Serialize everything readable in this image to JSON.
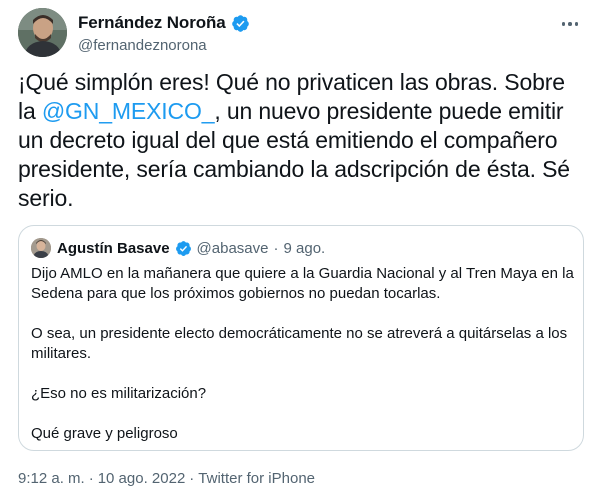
{
  "author": {
    "display_name": "Fernández Noroña",
    "handle": "@fernandeznorona",
    "avatar_icon": "avatar-photo"
  },
  "more_icon": "more-horizontal-icon",
  "tweet": {
    "text_before": "¡Qué simplón eres! Qué no privaticen las obras. Sobre la ",
    "mention": "@GN_MEXICO_",
    "text_after": ", un nuevo presidente puede emitir un decreto igual del que está emitiendo el compañero presidente, sería cambiando la adscripción de ésta. Sé serio."
  },
  "quote": {
    "display_name": "Agustín Basave",
    "handle": "@abasave",
    "separator": "·",
    "date": "9 ago.",
    "paragraphs": [
      "Dijo AMLO en la mañanera que quiere a la Guardia Nacional y al Tren Maya en la Sedena para que los próximos gobiernos no puedan tocarlas.",
      "O sea, un presidente electo democráticamente no se atreverá a quitárselas a los militares.",
      "¿Eso no es militarización?",
      "Qué grave y peligroso"
    ]
  },
  "meta": {
    "time": "9:12 a. m.",
    "sep1": "·",
    "date": "10 ago. 2022",
    "sep2": "·",
    "source": "Twitter for iPhone"
  },
  "colors": {
    "accent": "#1d9bf0",
    "secondary_text": "#536471",
    "border": "#cfd9de"
  }
}
